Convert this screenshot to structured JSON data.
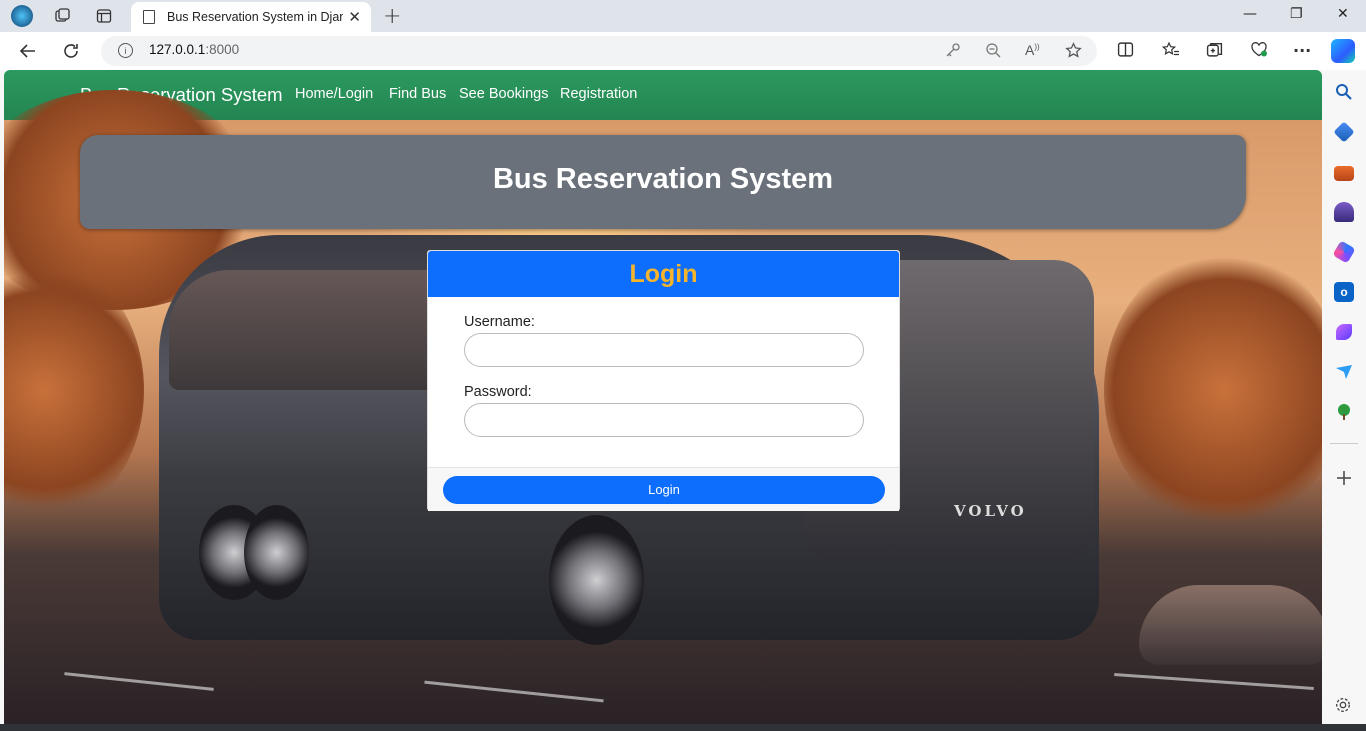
{
  "browser": {
    "tab_title": "Bus Reservation System in Django",
    "tab_close": "✕",
    "new_tab": "+",
    "url_host": "127.0.0.1",
    "url_port": ":8000",
    "minimize": "—",
    "restore": "❐",
    "close": "✕",
    "more": "···"
  },
  "navbar": {
    "brand": "Bus Reservation System",
    "links": [
      "Home/Login",
      "Find Bus",
      "See Bookings",
      "Registration"
    ]
  },
  "hero": {
    "title": "Bus Reservation System"
  },
  "login": {
    "title": "Login",
    "username_label": "Username:",
    "password_label": "Password:",
    "button": "Login"
  },
  "background": {
    "bus_brand": "VOLVO"
  },
  "colors": {
    "navbar": "#248552",
    "primary": "#0d6efd",
    "login_title": "#f4b52c",
    "hero": "#6b717a"
  }
}
